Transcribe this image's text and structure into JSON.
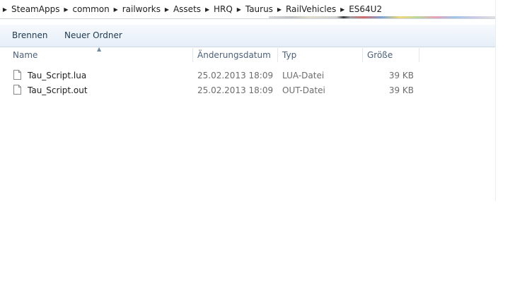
{
  "breadcrumbs": [
    "SteamApps",
    "common",
    "railworks",
    "Assets",
    "HRQ",
    "Taurus",
    "RailVehicles",
    "ES64U2"
  ],
  "toolbar": {
    "burn_label": "Brennen",
    "new_folder_label": "Neuer Ordner"
  },
  "columns": {
    "name": "Name",
    "date": "Änderungsdatum",
    "type": "Typ",
    "size": "Größe"
  },
  "sort_icon": "sort-ascending-caret-icon",
  "files": [
    {
      "name": "Tau_Script.lua",
      "date": "25.02.2013 18:09",
      "type": "LUA-Datei",
      "size": "39 KB",
      "icon": "document-icon"
    },
    {
      "name": "Tau_Script.out",
      "date": "25.02.2013 18:09",
      "type": "OUT-Datei",
      "size": "39 KB",
      "icon": "document-icon"
    }
  ]
}
